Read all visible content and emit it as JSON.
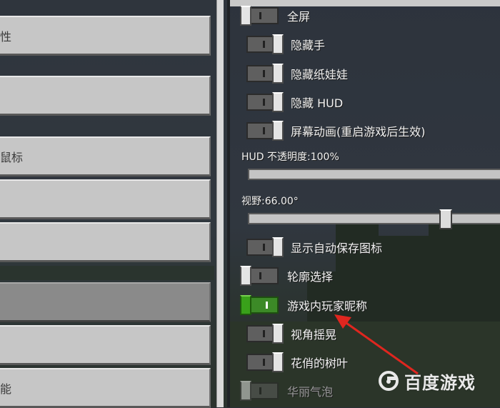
{
  "left_menu": {
    "items": [
      {
        "label": "性"
      },
      {
        "label": ""
      },
      {
        "label": "鼠标"
      },
      {
        "label": ""
      },
      {
        "label": ""
      },
      {
        "label": ""
      },
      {
        "label": ""
      },
      {
        "label": "能"
      }
    ]
  },
  "settings": {
    "fullscreen": {
      "label": "全屏",
      "state": "off"
    },
    "hide_hand": {
      "label": "隐藏手",
      "state": "off"
    },
    "hide_paperdoll": {
      "label": "隐藏纸娃娃",
      "state": "off"
    },
    "hide_hud": {
      "label": "隐藏 HUD",
      "state": "off"
    },
    "screen_animation": {
      "label": "屏幕动画(重启游戏后生效)",
      "state": "off"
    },
    "hud_opacity": {
      "label": "HUD 不透明度:100%",
      "value_percent": 100
    },
    "fov": {
      "label": "视野:66.00°",
      "value": 66.0,
      "slider_fraction": 0.75
    },
    "show_autosave_icon": {
      "label": "显示自动保存图标",
      "state": "off"
    },
    "outline_selection": {
      "label": "轮廓选择",
      "state": "off"
    },
    "ingame_player_names": {
      "label": "游戏内玩家昵称",
      "state": "on"
    },
    "view_bobbing": {
      "label": "视角摇晃",
      "state": "off"
    },
    "fancy_leaves": {
      "label": "花俏的树叶",
      "state": "off"
    },
    "fancy_bubbles": {
      "label": "华丽气泡",
      "state": "disabled"
    }
  },
  "watermark": {
    "text": "百度游戏"
  },
  "colors": {
    "toggle_on": "#39a11a",
    "button_gray": "#c6c6c6",
    "panel_bg": "#2a2f35"
  }
}
